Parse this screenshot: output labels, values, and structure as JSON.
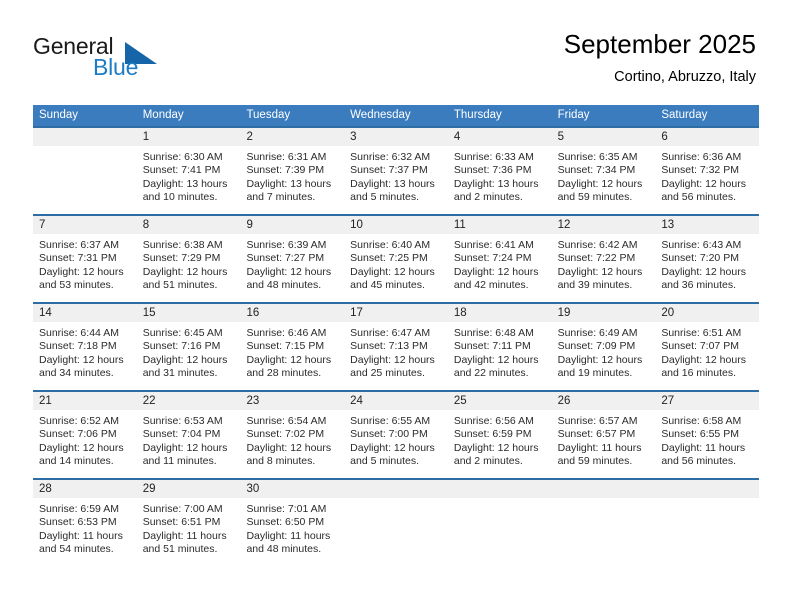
{
  "brand": {
    "name_part1": "General",
    "name_part2": "Blue",
    "triangle_color": "#1565a8",
    "blue_color": "#1d7cc4"
  },
  "header": {
    "title": "September 2025",
    "subtitle": "Cortino, Abruzzo, Italy"
  },
  "theme": {
    "header_row_bg": "#3b7cbf",
    "week_separator": "#2e6da4",
    "day_number_bg": "#f0f0f0",
    "text_color": "#2b2b2b"
  },
  "weekdays": [
    "Sunday",
    "Monday",
    "Tuesday",
    "Wednesday",
    "Thursday",
    "Friday",
    "Saturday"
  ],
  "weeks": [
    [
      {
        "day": "",
        "sunrise": "",
        "sunset": "",
        "daylight": ""
      },
      {
        "day": "1",
        "sunrise": "Sunrise: 6:30 AM",
        "sunset": "Sunset: 7:41 PM",
        "daylight": "Daylight: 13 hours and 10 minutes."
      },
      {
        "day": "2",
        "sunrise": "Sunrise: 6:31 AM",
        "sunset": "Sunset: 7:39 PM",
        "daylight": "Daylight: 13 hours and 7 minutes."
      },
      {
        "day": "3",
        "sunrise": "Sunrise: 6:32 AM",
        "sunset": "Sunset: 7:37 PM",
        "daylight": "Daylight: 13 hours and 5 minutes."
      },
      {
        "day": "4",
        "sunrise": "Sunrise: 6:33 AM",
        "sunset": "Sunset: 7:36 PM",
        "daylight": "Daylight: 13 hours and 2 minutes."
      },
      {
        "day": "5",
        "sunrise": "Sunrise: 6:35 AM",
        "sunset": "Sunset: 7:34 PM",
        "daylight": "Daylight: 12 hours and 59 minutes."
      },
      {
        "day": "6",
        "sunrise": "Sunrise: 6:36 AM",
        "sunset": "Sunset: 7:32 PM",
        "daylight": "Daylight: 12 hours and 56 minutes."
      }
    ],
    [
      {
        "day": "7",
        "sunrise": "Sunrise: 6:37 AM",
        "sunset": "Sunset: 7:31 PM",
        "daylight": "Daylight: 12 hours and 53 minutes."
      },
      {
        "day": "8",
        "sunrise": "Sunrise: 6:38 AM",
        "sunset": "Sunset: 7:29 PM",
        "daylight": "Daylight: 12 hours and 51 minutes."
      },
      {
        "day": "9",
        "sunrise": "Sunrise: 6:39 AM",
        "sunset": "Sunset: 7:27 PM",
        "daylight": "Daylight: 12 hours and 48 minutes."
      },
      {
        "day": "10",
        "sunrise": "Sunrise: 6:40 AM",
        "sunset": "Sunset: 7:25 PM",
        "daylight": "Daylight: 12 hours and 45 minutes."
      },
      {
        "day": "11",
        "sunrise": "Sunrise: 6:41 AM",
        "sunset": "Sunset: 7:24 PM",
        "daylight": "Daylight: 12 hours and 42 minutes."
      },
      {
        "day": "12",
        "sunrise": "Sunrise: 6:42 AM",
        "sunset": "Sunset: 7:22 PM",
        "daylight": "Daylight: 12 hours and 39 minutes."
      },
      {
        "day": "13",
        "sunrise": "Sunrise: 6:43 AM",
        "sunset": "Sunset: 7:20 PM",
        "daylight": "Daylight: 12 hours and 36 minutes."
      }
    ],
    [
      {
        "day": "14",
        "sunrise": "Sunrise: 6:44 AM",
        "sunset": "Sunset: 7:18 PM",
        "daylight": "Daylight: 12 hours and 34 minutes."
      },
      {
        "day": "15",
        "sunrise": "Sunrise: 6:45 AM",
        "sunset": "Sunset: 7:16 PM",
        "daylight": "Daylight: 12 hours and 31 minutes."
      },
      {
        "day": "16",
        "sunrise": "Sunrise: 6:46 AM",
        "sunset": "Sunset: 7:15 PM",
        "daylight": "Daylight: 12 hours and 28 minutes."
      },
      {
        "day": "17",
        "sunrise": "Sunrise: 6:47 AM",
        "sunset": "Sunset: 7:13 PM",
        "daylight": "Daylight: 12 hours and 25 minutes."
      },
      {
        "day": "18",
        "sunrise": "Sunrise: 6:48 AM",
        "sunset": "Sunset: 7:11 PM",
        "daylight": "Daylight: 12 hours and 22 minutes."
      },
      {
        "day": "19",
        "sunrise": "Sunrise: 6:49 AM",
        "sunset": "Sunset: 7:09 PM",
        "daylight": "Daylight: 12 hours and 19 minutes."
      },
      {
        "day": "20",
        "sunrise": "Sunrise: 6:51 AM",
        "sunset": "Sunset: 7:07 PM",
        "daylight": "Daylight: 12 hours and 16 minutes."
      }
    ],
    [
      {
        "day": "21",
        "sunrise": "Sunrise: 6:52 AM",
        "sunset": "Sunset: 7:06 PM",
        "daylight": "Daylight: 12 hours and 14 minutes."
      },
      {
        "day": "22",
        "sunrise": "Sunrise: 6:53 AM",
        "sunset": "Sunset: 7:04 PM",
        "daylight": "Daylight: 12 hours and 11 minutes."
      },
      {
        "day": "23",
        "sunrise": "Sunrise: 6:54 AM",
        "sunset": "Sunset: 7:02 PM",
        "daylight": "Daylight: 12 hours and 8 minutes."
      },
      {
        "day": "24",
        "sunrise": "Sunrise: 6:55 AM",
        "sunset": "Sunset: 7:00 PM",
        "daylight": "Daylight: 12 hours and 5 minutes."
      },
      {
        "day": "25",
        "sunrise": "Sunrise: 6:56 AM",
        "sunset": "Sunset: 6:59 PM",
        "daylight": "Daylight: 12 hours and 2 minutes."
      },
      {
        "day": "26",
        "sunrise": "Sunrise: 6:57 AM",
        "sunset": "Sunset: 6:57 PM",
        "daylight": "Daylight: 11 hours and 59 minutes."
      },
      {
        "day": "27",
        "sunrise": "Sunrise: 6:58 AM",
        "sunset": "Sunset: 6:55 PM",
        "daylight": "Daylight: 11 hours and 56 minutes."
      }
    ],
    [
      {
        "day": "28",
        "sunrise": "Sunrise: 6:59 AM",
        "sunset": "Sunset: 6:53 PM",
        "daylight": "Daylight: 11 hours and 54 minutes."
      },
      {
        "day": "29",
        "sunrise": "Sunrise: 7:00 AM",
        "sunset": "Sunset: 6:51 PM",
        "daylight": "Daylight: 11 hours and 51 minutes."
      },
      {
        "day": "30",
        "sunrise": "Sunrise: 7:01 AM",
        "sunset": "Sunset: 6:50 PM",
        "daylight": "Daylight: 11 hours and 48 minutes."
      },
      {
        "day": "",
        "sunrise": "",
        "sunset": "",
        "daylight": ""
      },
      {
        "day": "",
        "sunrise": "",
        "sunset": "",
        "daylight": ""
      },
      {
        "day": "",
        "sunrise": "",
        "sunset": "",
        "daylight": ""
      },
      {
        "day": "",
        "sunrise": "",
        "sunset": "",
        "daylight": ""
      }
    ]
  ]
}
